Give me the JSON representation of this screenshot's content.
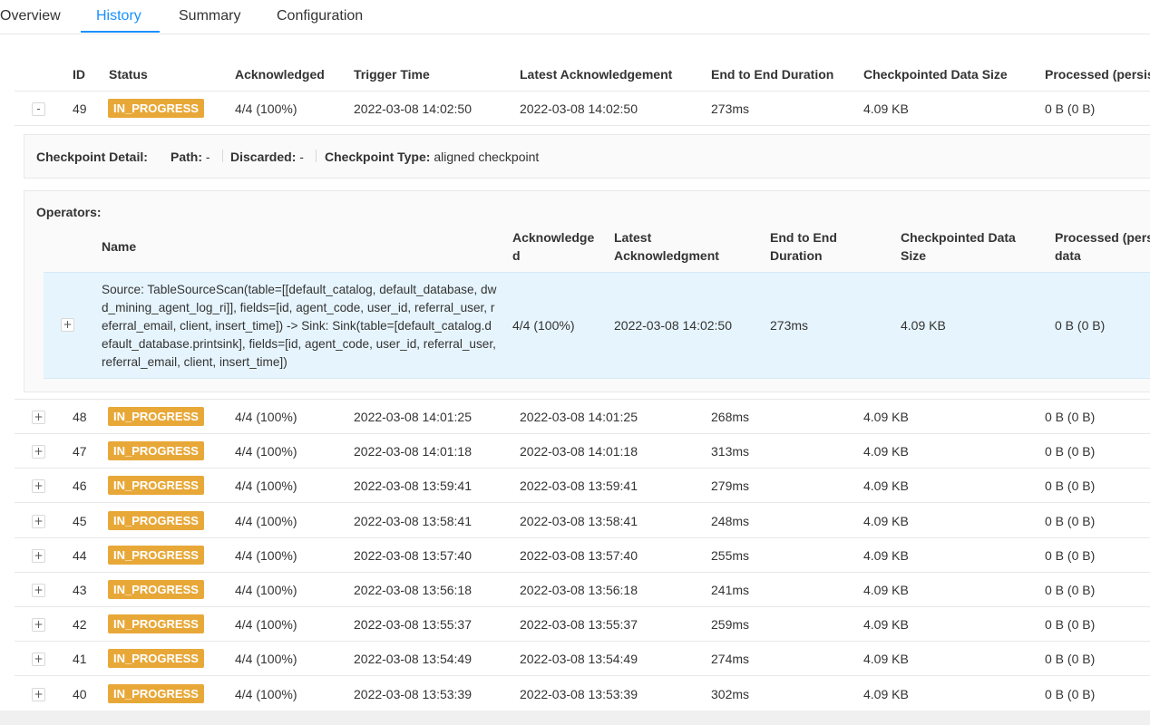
{
  "tabs": [
    "Overview",
    "History",
    "Summary",
    "Configuration"
  ],
  "columns": [
    "ID",
    "Status",
    "Acknowledged",
    "Trigger Time",
    "Latest Acknowledgement",
    "End to End Duration",
    "Checkpointed Data Size",
    "Processed (persis"
  ],
  "expanded_row": {
    "toggle": "-",
    "id": "49",
    "status": "IN_PROGRESS",
    "acknowledged": "4/4 (100%)",
    "trigger_time": "2022-03-08 14:02:50",
    "latest_ack": "2022-03-08 14:02:50",
    "duration": "273ms",
    "size": "4.09 KB",
    "processed": "0 B (0 B)"
  },
  "checkpoint_detail": {
    "title": "Checkpoint Detail:",
    "path_label": "Path:",
    "path_value": "-",
    "discarded_label": "Discarded:",
    "discarded_value": "-",
    "type_label": "Checkpoint Type:",
    "type_value": "aligned checkpoint"
  },
  "operators": {
    "title": "Operators:",
    "columns": {
      "name": "Name",
      "acknowledged": "Acknowledged",
      "latest_ack": "Latest Acknowledgment",
      "duration": "End to End Duration",
      "size": "Checkpointed Data Size",
      "processed": "Processed (persisted) data"
    },
    "row": {
      "toggle": "+",
      "name": "Source: TableSourceScan(table=[[default_catalog, default_database, dwd_mining_agent_log_ri]], fields=[id, agent_code, user_id, referral_user, referral_email, client, insert_time]) -> Sink: Sink(table=[default_catalog.default_database.printsink], fields=[id, agent_code, user_id, referral_user, referral_email, client, insert_time])",
      "acknowledged": "4/4 (100%)",
      "latest_ack": "2022-03-08 14:02:50",
      "duration": "273ms",
      "size": "4.09 KB",
      "processed": "0 B (0 B)"
    }
  },
  "rows": [
    {
      "toggle": "+",
      "id": "48",
      "status": "IN_PROGRESS",
      "acknowledged": "4/4 (100%)",
      "trigger_time": "2022-03-08 14:01:25",
      "latest_ack": "2022-03-08 14:01:25",
      "duration": "268ms",
      "size": "4.09 KB",
      "processed": "0 B (0 B)"
    },
    {
      "toggle": "+",
      "id": "47",
      "status": "IN_PROGRESS",
      "acknowledged": "4/4 (100%)",
      "trigger_time": "2022-03-08 14:01:18",
      "latest_ack": "2022-03-08 14:01:18",
      "duration": "313ms",
      "size": "4.09 KB",
      "processed": "0 B (0 B)"
    },
    {
      "toggle": "+",
      "id": "46",
      "status": "IN_PROGRESS",
      "acknowledged": "4/4 (100%)",
      "trigger_time": "2022-03-08 13:59:41",
      "latest_ack": "2022-03-08 13:59:41",
      "duration": "279ms",
      "size": "4.09 KB",
      "processed": "0 B (0 B)"
    },
    {
      "toggle": "+",
      "id": "45",
      "status": "IN_PROGRESS",
      "acknowledged": "4/4 (100%)",
      "trigger_time": "2022-03-08 13:58:41",
      "latest_ack": "2022-03-08 13:58:41",
      "duration": "248ms",
      "size": "4.09 KB",
      "processed": "0 B (0 B)"
    },
    {
      "toggle": "+",
      "id": "44",
      "status": "IN_PROGRESS",
      "acknowledged": "4/4 (100%)",
      "trigger_time": "2022-03-08 13:57:40",
      "latest_ack": "2022-03-08 13:57:40",
      "duration": "255ms",
      "size": "4.09 KB",
      "processed": "0 B (0 B)"
    },
    {
      "toggle": "+",
      "id": "43",
      "status": "IN_PROGRESS",
      "acknowledged": "4/4 (100%)",
      "trigger_time": "2022-03-08 13:56:18",
      "latest_ack": "2022-03-08 13:56:18",
      "duration": "241ms",
      "size": "4.09 KB",
      "processed": "0 B (0 B)"
    },
    {
      "toggle": "+",
      "id": "42",
      "status": "IN_PROGRESS",
      "acknowledged": "4/4 (100%)",
      "trigger_time": "2022-03-08 13:55:37",
      "latest_ack": "2022-03-08 13:55:37",
      "duration": "259ms",
      "size": "4.09 KB",
      "processed": "0 B (0 B)"
    },
    {
      "toggle": "+",
      "id": "41",
      "status": "IN_PROGRESS",
      "acknowledged": "4/4 (100%)",
      "trigger_time": "2022-03-08 13:54:49",
      "latest_ack": "2022-03-08 13:54:49",
      "duration": "274ms",
      "size": "4.09 KB",
      "processed": "0 B (0 B)"
    },
    {
      "toggle": "+",
      "id": "40",
      "status": "IN_PROGRESS",
      "acknowledged": "4/4 (100%)",
      "trigger_time": "2022-03-08 13:53:39",
      "latest_ack": "2022-03-08 13:53:39",
      "duration": "302ms",
      "size": "4.09 KB",
      "processed": "0 B (0 B)"
    }
  ]
}
